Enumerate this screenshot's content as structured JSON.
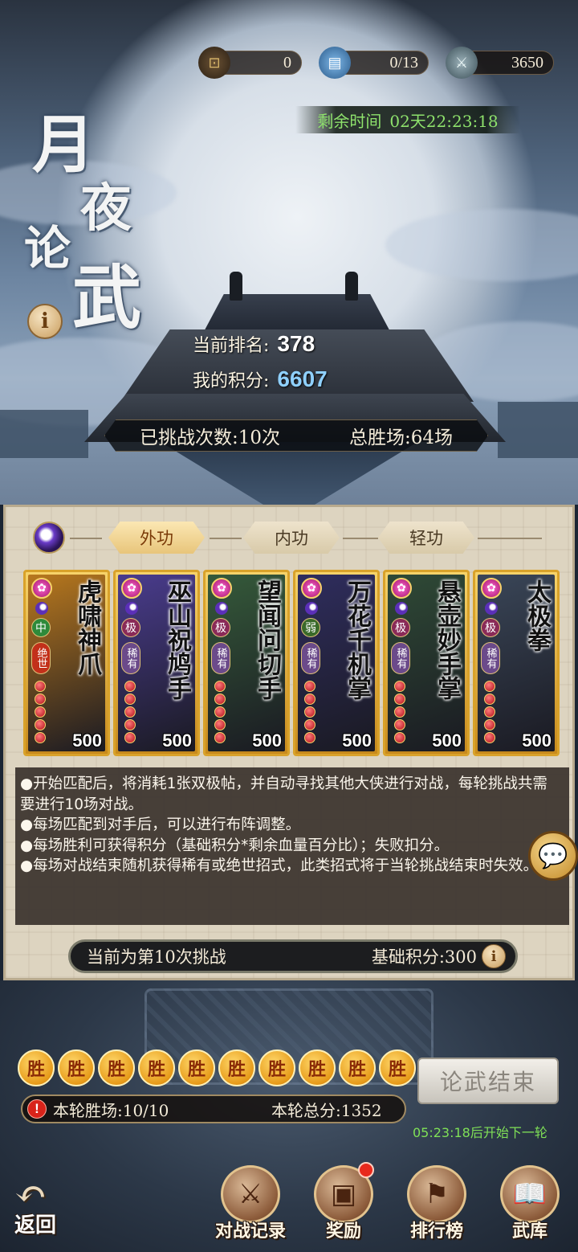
{
  "resources": [
    {
      "icon": "coin-icon",
      "value": "0"
    },
    {
      "icon": "ticket-icon",
      "value": "0/13"
    },
    {
      "icon": "sword-token-icon",
      "value": "3650"
    }
  ],
  "timer": {
    "label": "剩余时间",
    "value": "02天22:23:18"
  },
  "event_title": {
    "c1": "月",
    "c2": "夜",
    "c3": "论",
    "c4": "武"
  },
  "info_icon": "i",
  "ranking": {
    "rank_label": "当前排名:",
    "rank_value": "378",
    "score_label": "我的积分:",
    "score_value": "6607"
  },
  "stats": {
    "challenges": "已挑战次数:10次",
    "total_wins": "总胜场:64场"
  },
  "tabs": [
    {
      "label": "外功",
      "active": true
    },
    {
      "label": "内功",
      "active": false
    },
    {
      "label": "轻功",
      "active": false
    }
  ],
  "cards": [
    {
      "name": "虎啸神爪",
      "grade": "中",
      "tag": "绝世",
      "score": "500",
      "grade_color": "#2e8a3a",
      "tag_color": "#c2301a",
      "bg": "#b8781e"
    },
    {
      "name": "巫山祝鸠手",
      "grade": "极",
      "tag": "稀有",
      "score": "500",
      "grade_color": "#8a2a58",
      "tag_color": "#6b4a8a",
      "bg": "#4a3c8e"
    },
    {
      "name": "望闻问切手",
      "grade": "极",
      "tag": "稀有",
      "score": "500",
      "grade_color": "#8a2a58",
      "tag_color": "#6b4a8a",
      "bg": "#355a3a"
    },
    {
      "name": "万花千机掌",
      "grade": "弱",
      "tag": "稀有",
      "score": "500",
      "grade_color": "#3a6a2a",
      "tag_color": "#6b4a8a",
      "bg": "#2f2d5e"
    },
    {
      "name": "悬壶妙手掌",
      "grade": "极",
      "tag": "稀有",
      "score": "500",
      "grade_color": "#8a2a58",
      "tag_color": "#6b4a8a",
      "bg": "#2f4a36"
    },
    {
      "name": "太极拳",
      "grade": "极",
      "tag": "稀有",
      "score": "500",
      "grade_color": "#8a2a58",
      "tag_color": "#6b4a8a",
      "bg": "#3a4658"
    }
  ],
  "rules": [
    "●开始匹配后，将消耗1张双极帖，并自动寻找其他大侠进行对战，每轮挑战共需要进行10场对战。",
    "●每场匹配到对手后，可以进行布阵调整。",
    "●每场胜利可获得积分（基础积分*剩余血量百分比）；失败扣分。",
    "●每场对战结束随机获得稀有或绝世招式，此类招式将于当轮挑战结束时失效。"
  ],
  "challenge": {
    "current": "当前为第10次挑战",
    "base_score": "基础积分:300"
  },
  "wins": [
    "胜",
    "胜",
    "胜",
    "胜",
    "胜",
    "胜",
    "胜",
    "胜",
    "胜",
    "胜"
  ],
  "end_button": "论武结束",
  "round": {
    "wins": "本轮胜场:10/10",
    "total": "本轮总分:1352",
    "warn_icon": "!"
  },
  "next_round": "05:23:18后开始下一轮",
  "nav": {
    "back": "返回",
    "items": [
      {
        "label": "对战记录",
        "icon": "crossed-swords-scroll-icon"
      },
      {
        "label": "奖励",
        "icon": "treasure-chest-icon"
      },
      {
        "label": "排行榜",
        "icon": "ranking-banner-icon"
      },
      {
        "label": "武库",
        "icon": "open-book-icon"
      }
    ]
  },
  "colors": {
    "accent_gold": "#e8c57b",
    "timer_green": "#8ee26c",
    "score_blue": "#8fd0ff"
  }
}
